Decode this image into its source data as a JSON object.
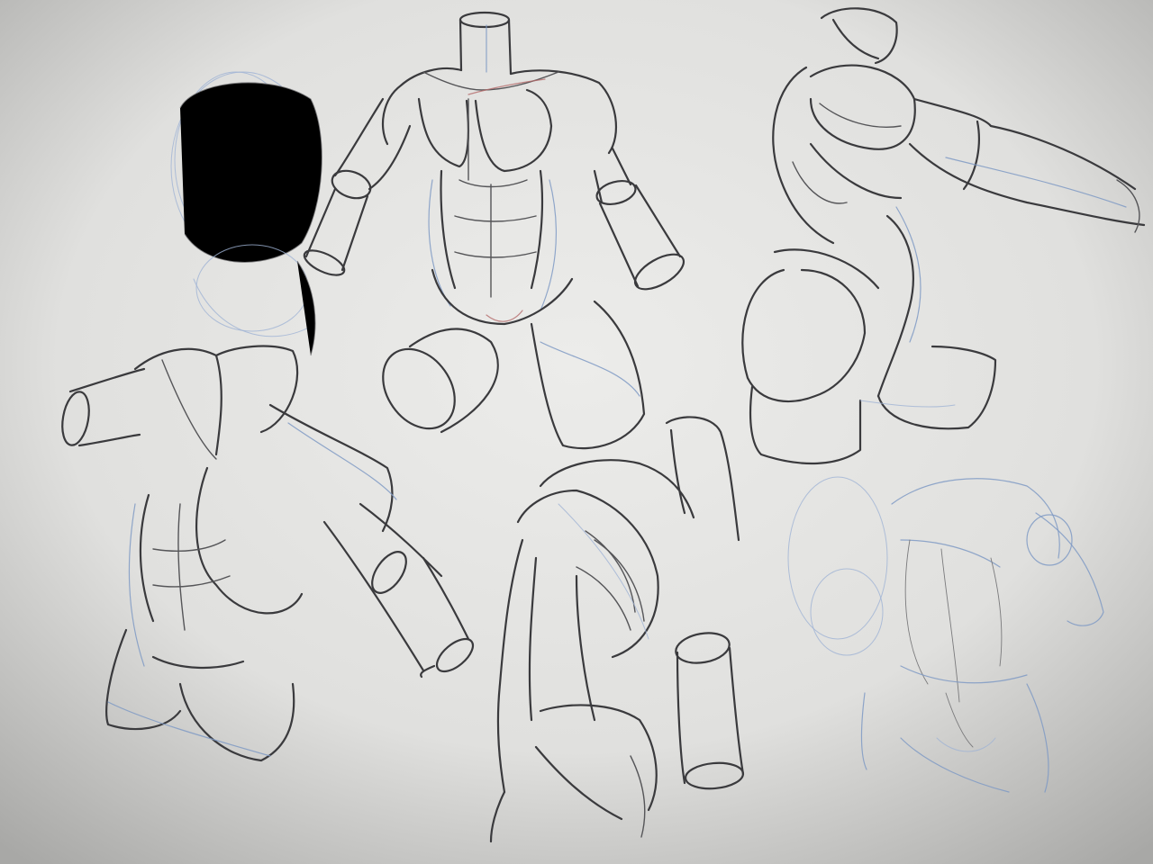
{
  "scene": {
    "colors": {
      "paper": "#e4e4e2",
      "paper_edge": "#a9a9a7",
      "graphite": "#3a3a3d",
      "blue_pencil": "#7f9ac4",
      "red_pencil": "#b46a6a"
    }
  }
}
